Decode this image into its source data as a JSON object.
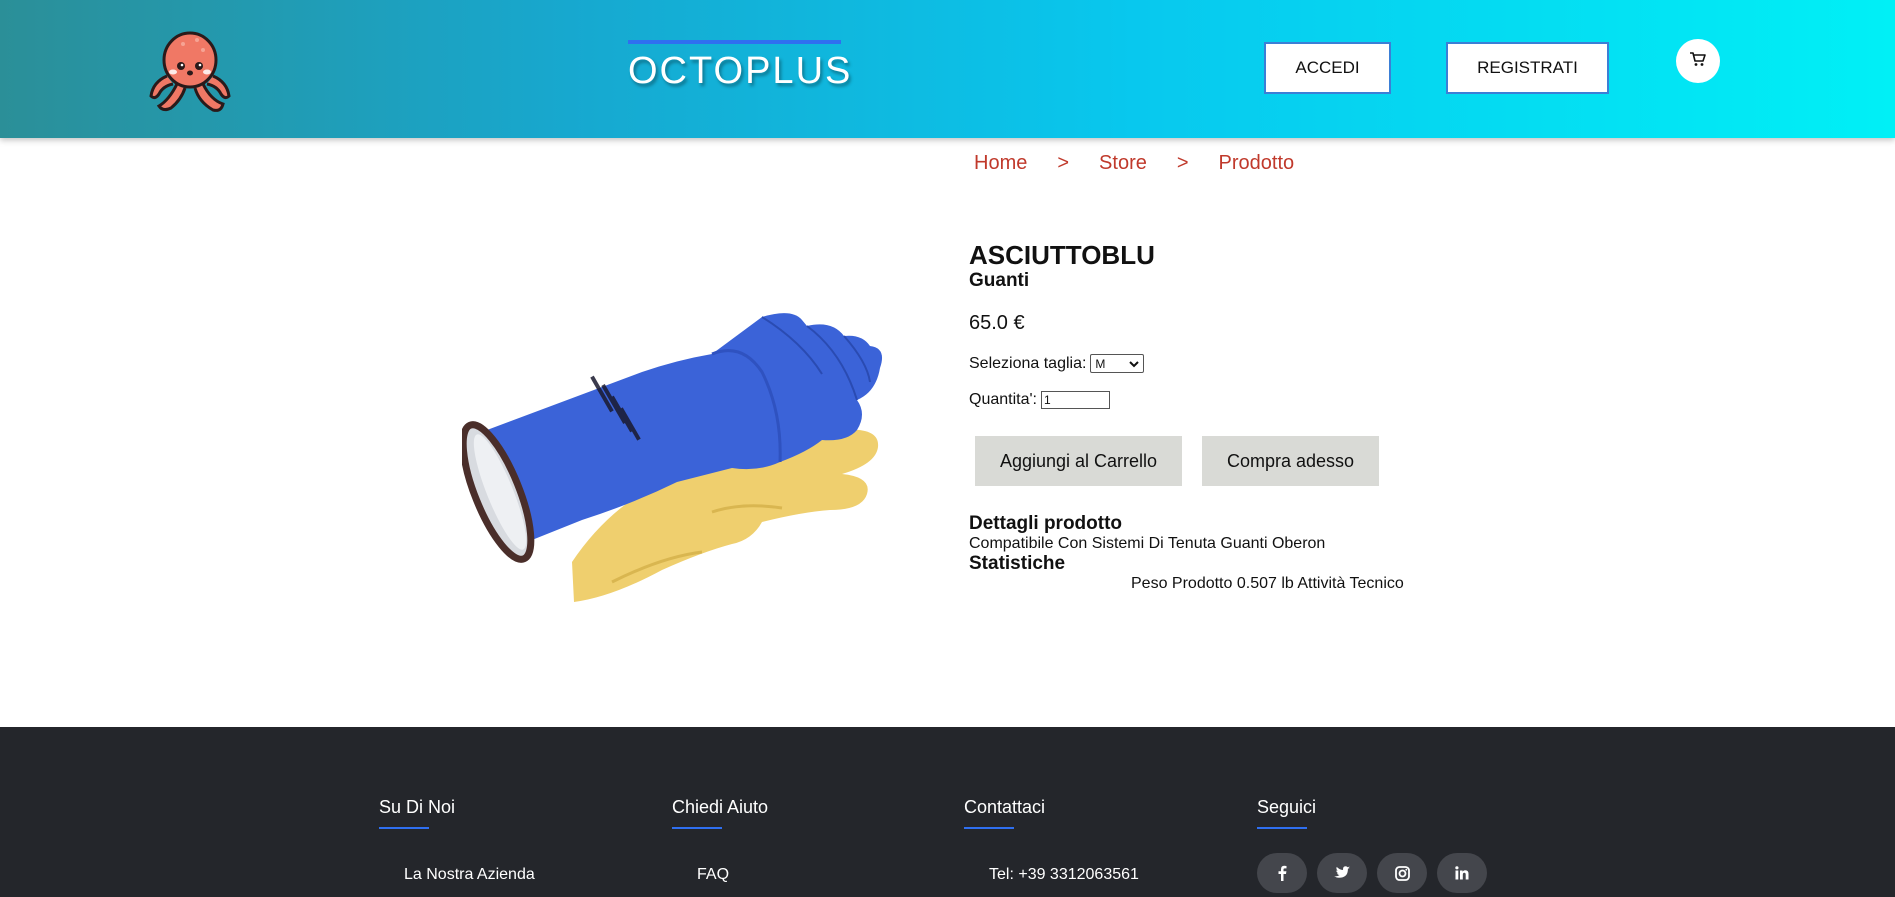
{
  "header": {
    "brand": "OCTOPLUS",
    "login_label": "ACCEDI",
    "register_label": "REGISTRATI",
    "logo_icon": "octopus-logo-icon",
    "cart_icon": "cart-icon",
    "gradient_start": "#2b8f98",
    "gradient_end": "#00f0f6"
  },
  "breadcrumb": {
    "items": [
      "Home",
      "Store",
      "Prodotto"
    ],
    "separator": ">"
  },
  "product": {
    "name": "ASCIUTTOBLU",
    "category": "Guanti",
    "price": "65.0 €",
    "size_label": "Seleziona taglia:",
    "size_selected": "M",
    "quantity_label": "Quantita':",
    "quantity_value": "1",
    "add_to_cart_label": "Aggiungi al Carrello",
    "buy_now_label": "Compra adesso",
    "details_title": "Dettagli prodotto",
    "details_text": "Compatibile Con Sistemi Di Tenuta Guanti Oberon",
    "stats_title": "Statistiche",
    "stats_text": "Peso Prodotto 0.507 lb Attività Tecnico",
    "image_icon": "dive-glove-image"
  },
  "footer": {
    "columns": [
      {
        "title": "Su Di Noi",
        "link": "La Nostra Azienda"
      },
      {
        "title": "Chiedi Aiuto",
        "link": "FAQ"
      },
      {
        "title": "Contattaci",
        "link": "Tel: +39 3312063561"
      },
      {
        "title": "Seguici",
        "link": ""
      }
    ],
    "social": [
      "facebook-icon",
      "twitter-icon",
      "instagram-icon",
      "linkedin-icon"
    ],
    "background": "#24262b",
    "accent": "#2f6ff0"
  },
  "colors": {
    "breadcrumb": "#c0392b",
    "button_gray": "#d9dad6"
  }
}
